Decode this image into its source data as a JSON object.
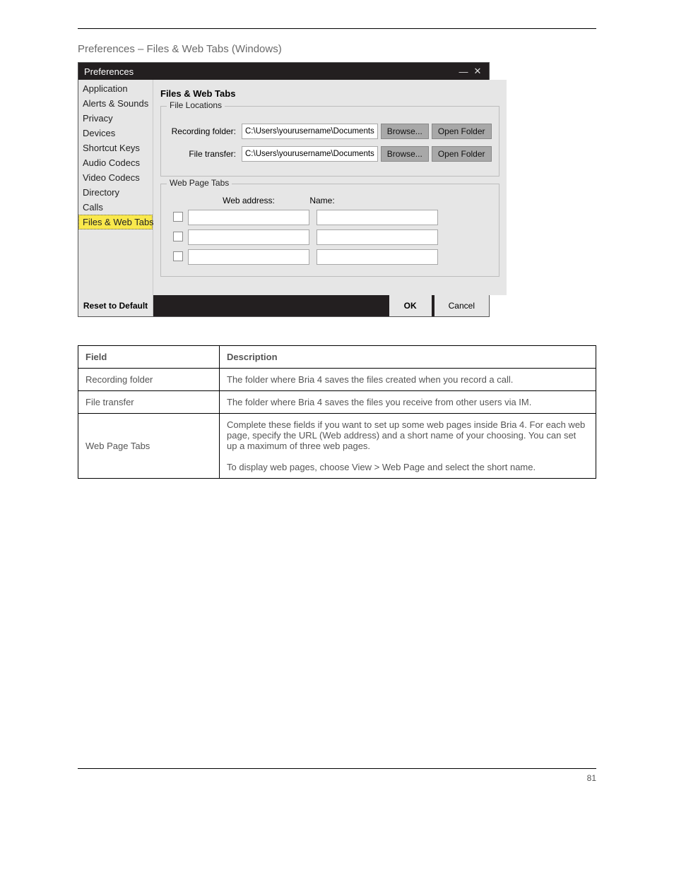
{
  "page": {
    "heading": "Preferences – Files & Web Tabs (Windows)",
    "page_number": "81"
  },
  "dialog": {
    "title": "Preferences",
    "content_title": "Files & Web Tabs",
    "sidebar": [
      "Application",
      "Alerts & Sounds",
      "Privacy",
      "Devices",
      "Shortcut Keys",
      "Audio Codecs",
      "Video Codecs",
      "Directory",
      "Calls",
      "Files & Web Tabs"
    ],
    "file_locations": {
      "group_title": "File Locations",
      "recording_label": "Recording folder:",
      "recording_value": "C:\\Users\\yourusername\\Documents",
      "transfer_label": "File transfer:",
      "transfer_value": "C:\\Users\\yourusername\\Documents",
      "browse_label": "Browse...",
      "open_label": "Open Folder"
    },
    "web_tabs": {
      "group_title": "Web Page Tabs",
      "col_web": "Web address:",
      "col_name": "Name:"
    },
    "footer": {
      "reset": "Reset to Default",
      "ok": "OK",
      "cancel": "Cancel"
    }
  },
  "table": {
    "head_field": "Field",
    "head_desc": "Description",
    "rows": [
      {
        "field": "Recording folder",
        "desc": "The folder where Bria 4 saves the files created when you record a call."
      },
      {
        "field": "File transfer",
        "desc": "The folder where Bria 4 saves the files you receive from other users via IM."
      },
      {
        "field": "Web Page Tabs",
        "desc": "Complete these fields if you want to set up some web pages inside Bria 4. For each web page, specify the URL (Web address) and a short name of your choosing. You can set up a maximum of three web pages.\n\nTo display web pages, choose View > Web Page and select the short name."
      }
    ]
  }
}
